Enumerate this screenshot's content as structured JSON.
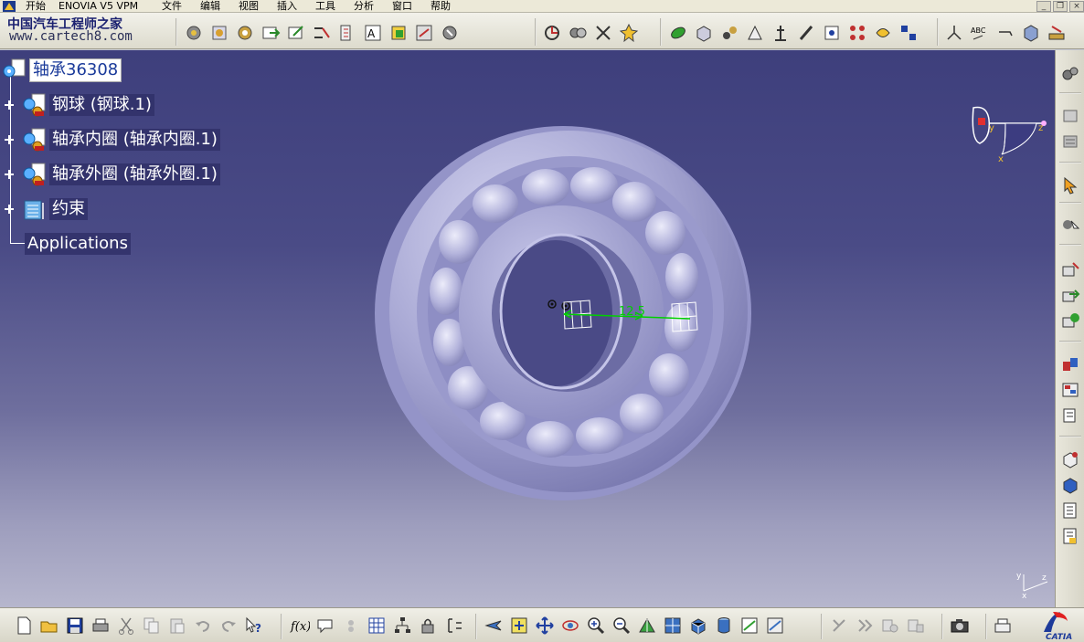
{
  "menubar": {
    "start": "开始",
    "enovia": "ENOVIA V5 VPM",
    "items": [
      "文件",
      "编辑",
      "视图",
      "插入",
      "工具",
      "分析",
      "窗口",
      "帮助"
    ]
  },
  "watermark": {
    "title": "中国汽车工程师之家",
    "url": "www.cartech8.com"
  },
  "tree": {
    "root": "轴承36308",
    "children": [
      {
        "label": "钢球 (钢球.1)"
      },
      {
        "label": "轴承内圈 (轴承内圈.1)"
      },
      {
        "label": "轴承外圈 (轴承外圈.1)"
      },
      {
        "label": "约束"
      }
    ],
    "applications": "Applications"
  },
  "constraint": {
    "dimension": "12.5"
  },
  "compass": {
    "axis_y": "y",
    "axis_z": "z",
    "axis_x": "x"
  },
  "axis_mini": {
    "y": "y",
    "z": "z",
    "x": "x"
  },
  "brand": {
    "catia": "CATIA"
  },
  "colors": {
    "viewport_top": "#3e3f7c",
    "viewport_bottom": "#b6b6cd",
    "bearing": "#a9a9d6",
    "constraint_green": "#00d000",
    "selection": "#1a3a9a"
  }
}
